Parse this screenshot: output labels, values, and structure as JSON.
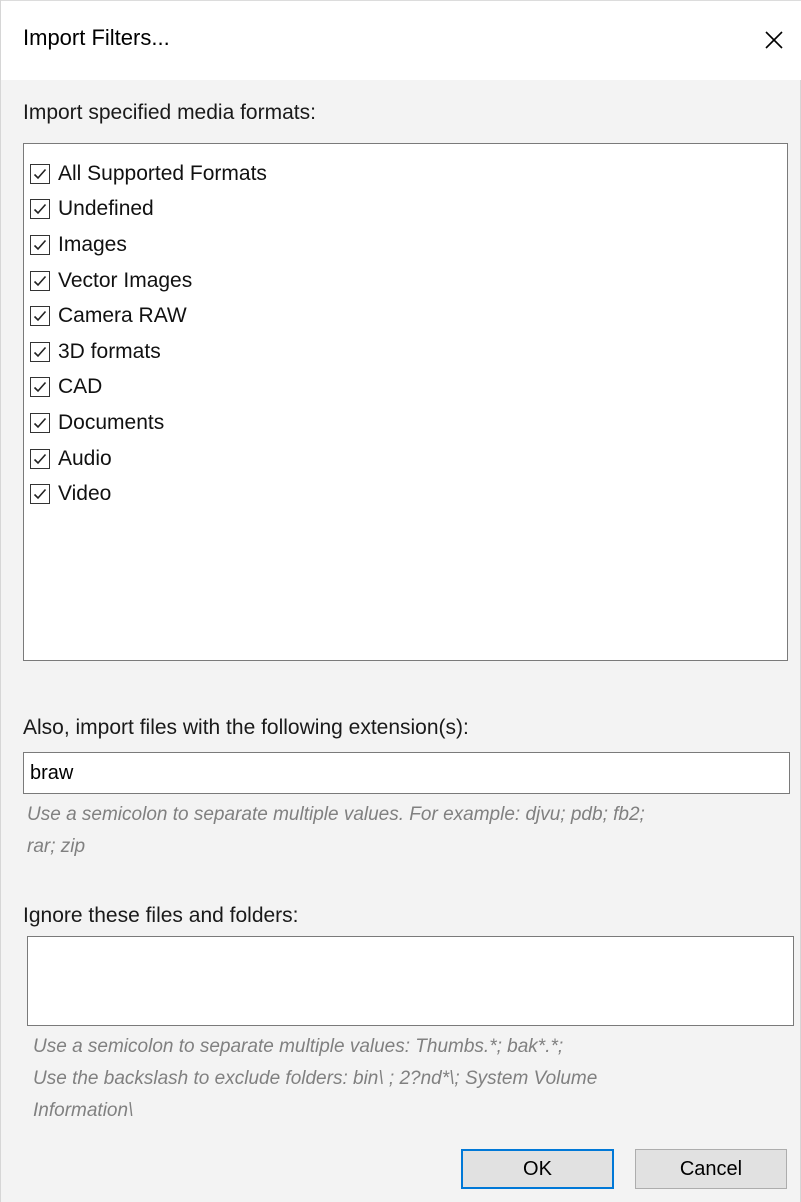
{
  "window": {
    "title": "Import Filters...",
    "close_icon": "close-icon"
  },
  "formats": {
    "label": "Import specified media formats:",
    "items": [
      {
        "label": "All Supported Formats",
        "checked": true
      },
      {
        "label": "Undefined",
        "checked": true
      },
      {
        "label": "Images",
        "checked": true
      },
      {
        "label": "Vector Images",
        "checked": true
      },
      {
        "label": "Camera RAW",
        "checked": true
      },
      {
        "label": "3D formats",
        "checked": true
      },
      {
        "label": "CAD",
        "checked": true
      },
      {
        "label": "Documents",
        "checked": true
      },
      {
        "label": "Audio",
        "checked": true
      },
      {
        "label": "Video",
        "checked": true
      }
    ]
  },
  "extensions": {
    "label": "Also, import files with the following extension(s):",
    "value": "braw",
    "hint_line1": "Use a semicolon to separate multiple values. For example: djvu; pdb; fb2;",
    "hint_line2": "rar; zip"
  },
  "ignore": {
    "label": "Ignore these files and folders:",
    "value": "",
    "hint_line1": "Use a semicolon to separate multiple values: Thumbs.*;  bak*.*;",
    "hint_line2": "Use the backslash to exclude folders: bin\\ ; 2?nd*\\; System Volume",
    "hint_line3": "Information\\"
  },
  "buttons": {
    "ok_label": "OK",
    "cancel_label": "Cancel"
  },
  "colors": {
    "accent": "#0078d7",
    "hint_text": "#808080",
    "dialog_bg": "#f3f3f3"
  }
}
